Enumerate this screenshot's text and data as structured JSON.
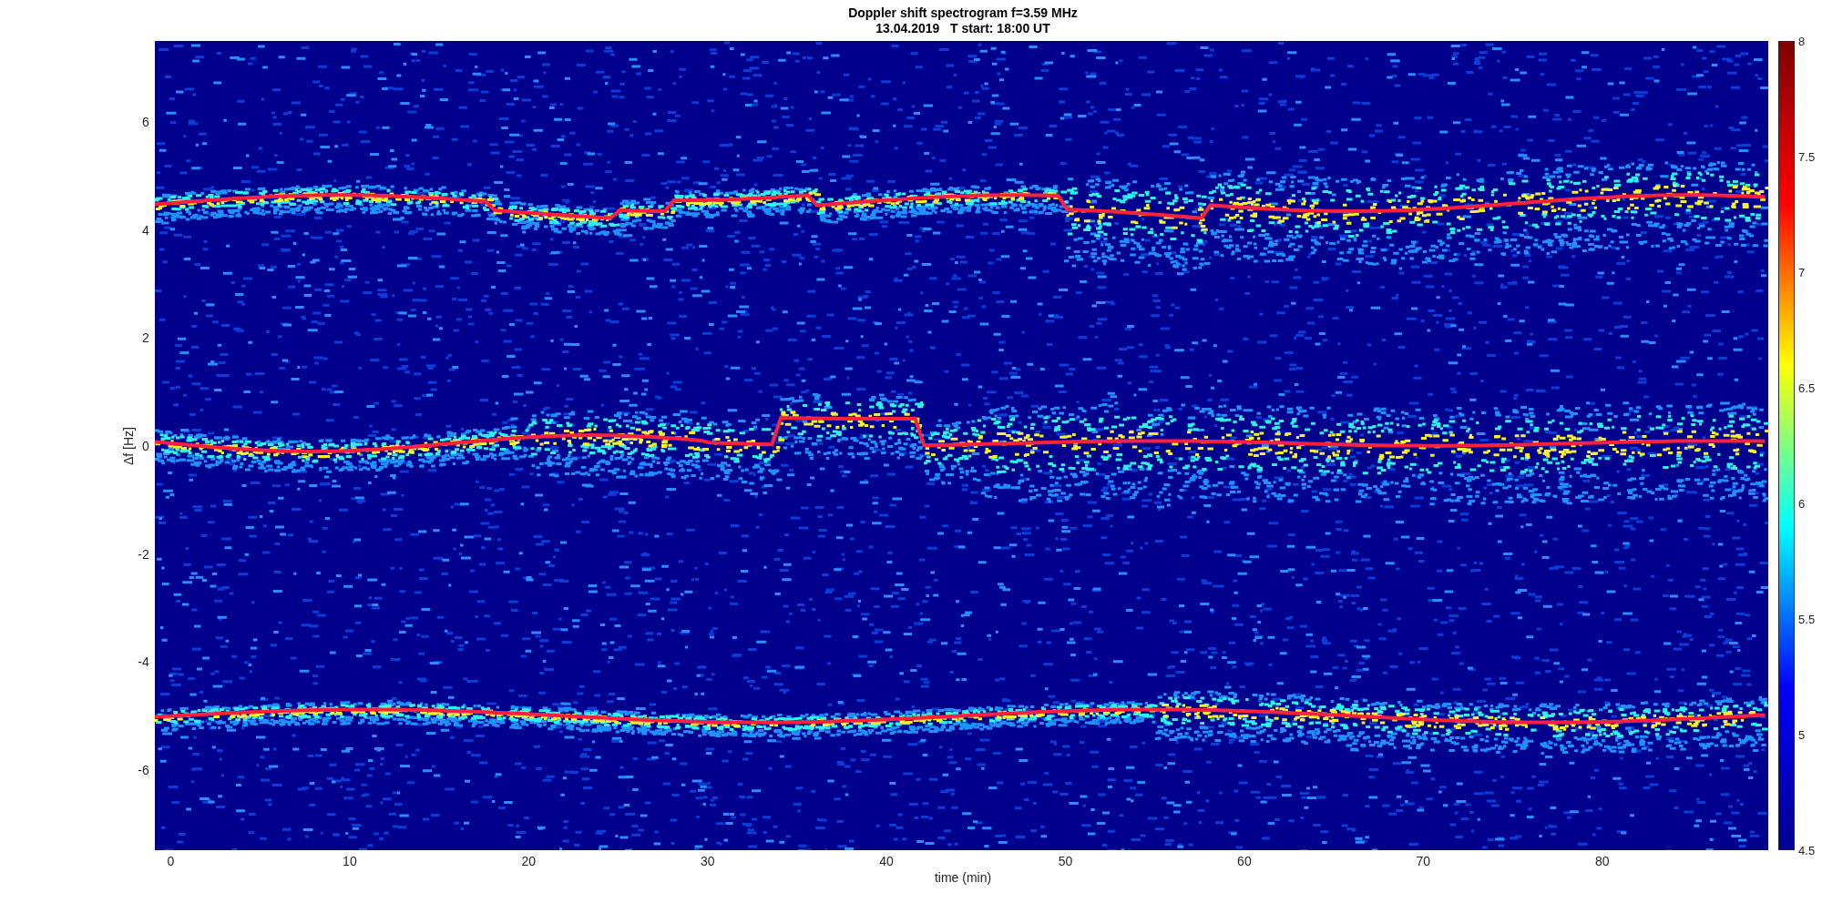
{
  "figure": {
    "title_lines": [
      "Doppler shift spectrogram f=3.59 MHz",
      "13.04.2019   T start: 18:00 UT"
    ],
    "xlabel": "time (min)",
    "ylabel": "Δf [Hz]",
    "xticks": [
      "0",
      "10",
      "20",
      "30",
      "40",
      "50",
      "60",
      "70",
      "80"
    ],
    "yticks": [
      "6",
      "4",
      "2",
      "0",
      "-2",
      "-4",
      "-6"
    ],
    "colorbar_ticks": [
      "8",
      "7.5",
      "7",
      "6.5",
      "6",
      "5.5",
      "5",
      "4.5"
    ]
  }
}
